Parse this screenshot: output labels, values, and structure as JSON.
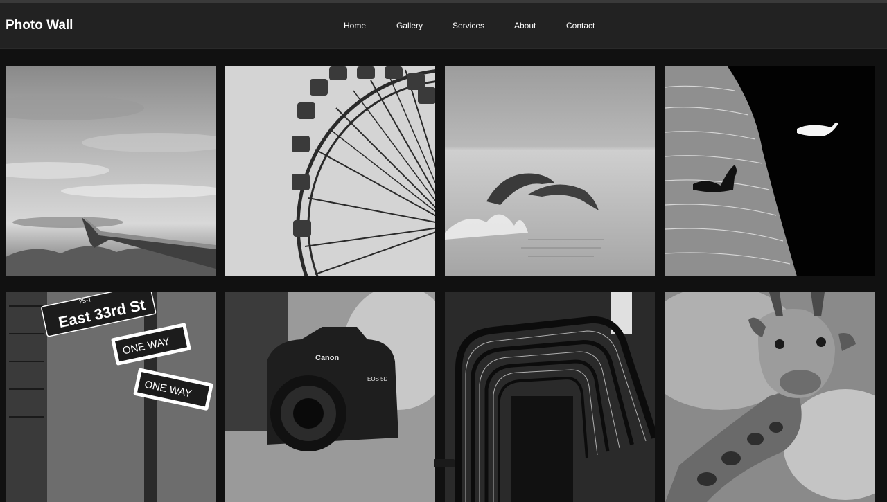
{
  "header": {
    "brand": "Photo Wall",
    "nav": [
      {
        "label": "Home"
      },
      {
        "label": "Gallery"
      },
      {
        "label": "Services"
      },
      {
        "label": "About"
      },
      {
        "label": "Contact"
      }
    ]
  },
  "gallery": {
    "photos": [
      {
        "subject": "airplane-wing-over-clouds"
      },
      {
        "subject": "ferris-wheel"
      },
      {
        "subject": "leaping-dolphins"
      },
      {
        "subject": "swans-on-dark-water"
      },
      {
        "subject": "street-signs",
        "sign_text": "East 33rd St",
        "sign_number": "25-1",
        "arrow_label": "ONE WAY"
      },
      {
        "subject": "canon-camera",
        "brand": "Canon",
        "model": "EOS 5D"
      },
      {
        "subject": "spiral-staircase"
      },
      {
        "subject": "giraffe"
      }
    ]
  },
  "colors": {
    "page_bg": "#111111",
    "header_bg": "#222222",
    "text": "#ffffff"
  }
}
